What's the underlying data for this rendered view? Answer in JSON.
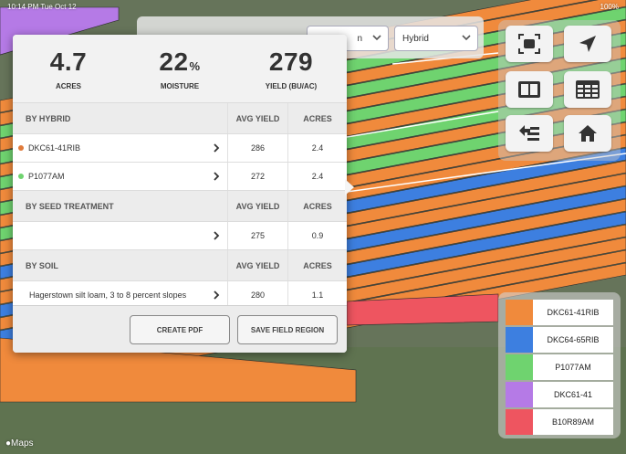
{
  "status_bar": {
    "time_date": "10:14 PM  Tue Oct 12",
    "battery": "100%"
  },
  "toolbar": {
    "field_partial": "n",
    "hybrid_select": "Hybrid"
  },
  "summary": {
    "acres": {
      "value": "4.7",
      "label": "ACRES"
    },
    "moisture": {
      "value": "22",
      "unit": "%",
      "label": "MOISTURE"
    },
    "yield": {
      "value": "279",
      "label": "YIELD (BU/AC)"
    }
  },
  "by_hybrid": {
    "header": {
      "name": "BY HYBRID",
      "avg_yield": "AVG YIELD",
      "acres": "ACRES"
    },
    "rows": [
      {
        "name": "DKC61-41RIB",
        "avg_yield": "286",
        "acres": "2.4",
        "dot_color": "#e07a3a"
      },
      {
        "name": "P1077AM",
        "avg_yield": "272",
        "acres": "2.4",
        "dot_color": "#6fd36f"
      }
    ]
  },
  "by_seed_treatment": {
    "header": {
      "name": "BY SEED TREATMENT",
      "avg_yield": "AVG YIELD",
      "acres": "ACRES"
    },
    "rows": [
      {
        "name": "",
        "avg_yield": "275",
        "acres": "0.9"
      }
    ]
  },
  "by_soil": {
    "header": {
      "name": "BY SOIL",
      "avg_yield": "AVG YIELD",
      "acres": "ACRES"
    },
    "rows": [
      {
        "name": "Hagerstown silt loam, 3 to 8 percent slopes",
        "avg_yield": "280",
        "acres": "1.1"
      }
    ]
  },
  "actions": {
    "create_pdf": "CREATE PDF",
    "save_region": "SAVE FIELD REGION"
  },
  "tools": [
    "focus-frame-icon",
    "location-arrow-icon",
    "split-view-icon",
    "table-icon",
    "layer-swap-icon",
    "home-icon"
  ],
  "legend": [
    {
      "label": "DKC61-41RIB",
      "color": "#f08a3c"
    },
    {
      "label": "DKC64-65RIB",
      "color": "#3d7fe0"
    },
    {
      "label": "P1077AM",
      "color": "#6fd36f"
    },
    {
      "label": "DKC61-41",
      "color": "#b57ae6"
    },
    {
      "label": "B10R89AM",
      "color": "#ee5560"
    }
  ],
  "map_attribution": "Maps"
}
